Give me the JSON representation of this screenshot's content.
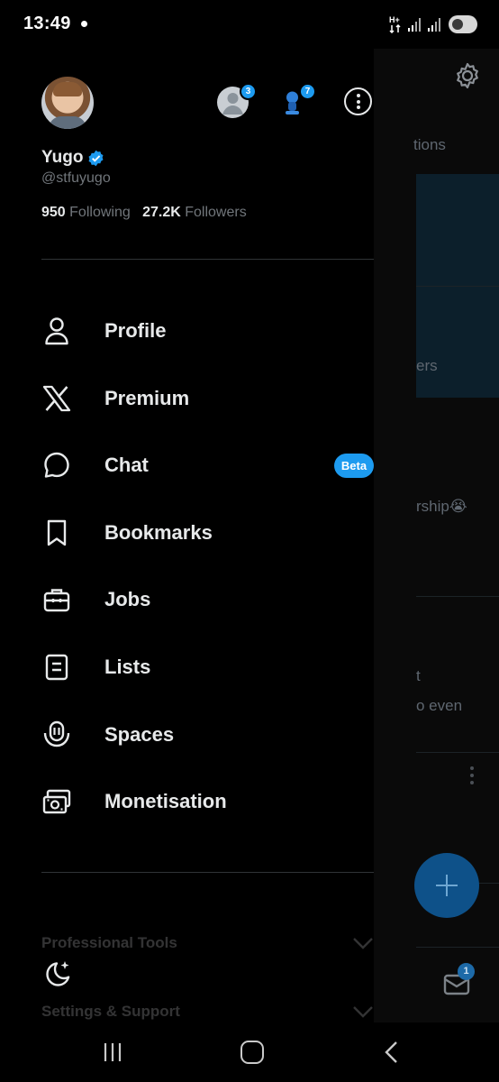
{
  "status_bar": {
    "time": "13:49",
    "network_type": "H+"
  },
  "timeline": {
    "tab_partial": "tions",
    "snippet_1": "ers",
    "snippet_2": "rship😭",
    "snippet_3": "t",
    "snippet_4": "o even",
    "messages_badge": "1"
  },
  "drawer": {
    "profile": {
      "display_name": "Yugo",
      "handle": "@stfuyugo",
      "following_count": "950",
      "following_label": "Following",
      "followers_count": "27.2K",
      "followers_label": "Followers",
      "verified": true
    },
    "accounts": [
      {
        "badge": "3",
        "icon": "default-avatar-icon"
      },
      {
        "badge": "7",
        "icon": "blue-figure-avatar-icon"
      }
    ],
    "menu": [
      {
        "label": "Profile",
        "icon": "person-icon"
      },
      {
        "label": "Premium",
        "icon": "x-logo-icon"
      },
      {
        "label": "Chat",
        "icon": "chat-bubble-icon",
        "badge": "Beta"
      },
      {
        "label": "Bookmarks",
        "icon": "bookmark-icon"
      },
      {
        "label": "Jobs",
        "icon": "briefcase-icon"
      },
      {
        "label": "Lists",
        "icon": "list-icon"
      },
      {
        "label": "Spaces",
        "icon": "spaces-icon"
      },
      {
        "label": "Monetisation",
        "icon": "money-icon"
      }
    ],
    "sections": [
      {
        "label": "Professional Tools"
      },
      {
        "label": "Settings & Support"
      }
    ]
  },
  "colors": {
    "accent": "#1d9bf0",
    "background": "#000000",
    "text_primary": "#e7e9ea",
    "text_secondary": "#71767b",
    "divider": "#2f3336"
  }
}
